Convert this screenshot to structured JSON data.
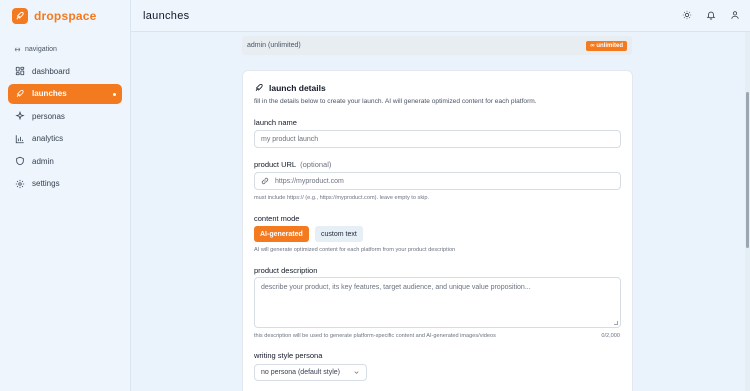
{
  "brand": {
    "name": "dropspace"
  },
  "sidebar": {
    "heading": "navigation",
    "items": [
      {
        "label": "dashboard",
        "icon": "grid-icon"
      },
      {
        "label": "launches",
        "icon": "rocket-icon",
        "active": true
      },
      {
        "label": "personas",
        "icon": "sparkle-icon"
      },
      {
        "label": "analytics",
        "icon": "bar-chart-icon"
      },
      {
        "label": "admin",
        "icon": "shield-icon"
      },
      {
        "label": "settings",
        "icon": "gear-icon"
      }
    ]
  },
  "topbar": {
    "title": "launches",
    "icons": [
      "sun-icon",
      "bell-icon",
      "user-icon"
    ]
  },
  "plan": {
    "text": "admin (unlimited)",
    "badge": "∞ unlimited"
  },
  "form": {
    "title": "launch details",
    "subtitle": "fill in the details below to create your launch. AI will generate optimized content for each platform.",
    "launch_name": {
      "label": "launch name",
      "placeholder": "my product launch"
    },
    "product_url": {
      "label": "product URL",
      "optional": "(optional)",
      "placeholder": "https://myproduct.com",
      "help": "must include https:// (e.g., https://myproduct.com). leave empty to skip."
    },
    "content_mode": {
      "label": "content mode",
      "options": [
        "AI-generated",
        "custom text"
      ],
      "selected": "AI-generated",
      "help": "AI will generate optimized content for each platform from your product description"
    },
    "description": {
      "label": "product description",
      "placeholder": "describe your product, its key features, target audience, and unique value proposition...",
      "help": "this description will be used to generate platform-specific content and AI-generated images/videos",
      "counter": "0/2,000"
    },
    "persona": {
      "label": "writing style persona",
      "value": "no persona (default style)"
    }
  },
  "colors": {
    "accent": "#f47a20",
    "background": "#eaf3fb"
  }
}
